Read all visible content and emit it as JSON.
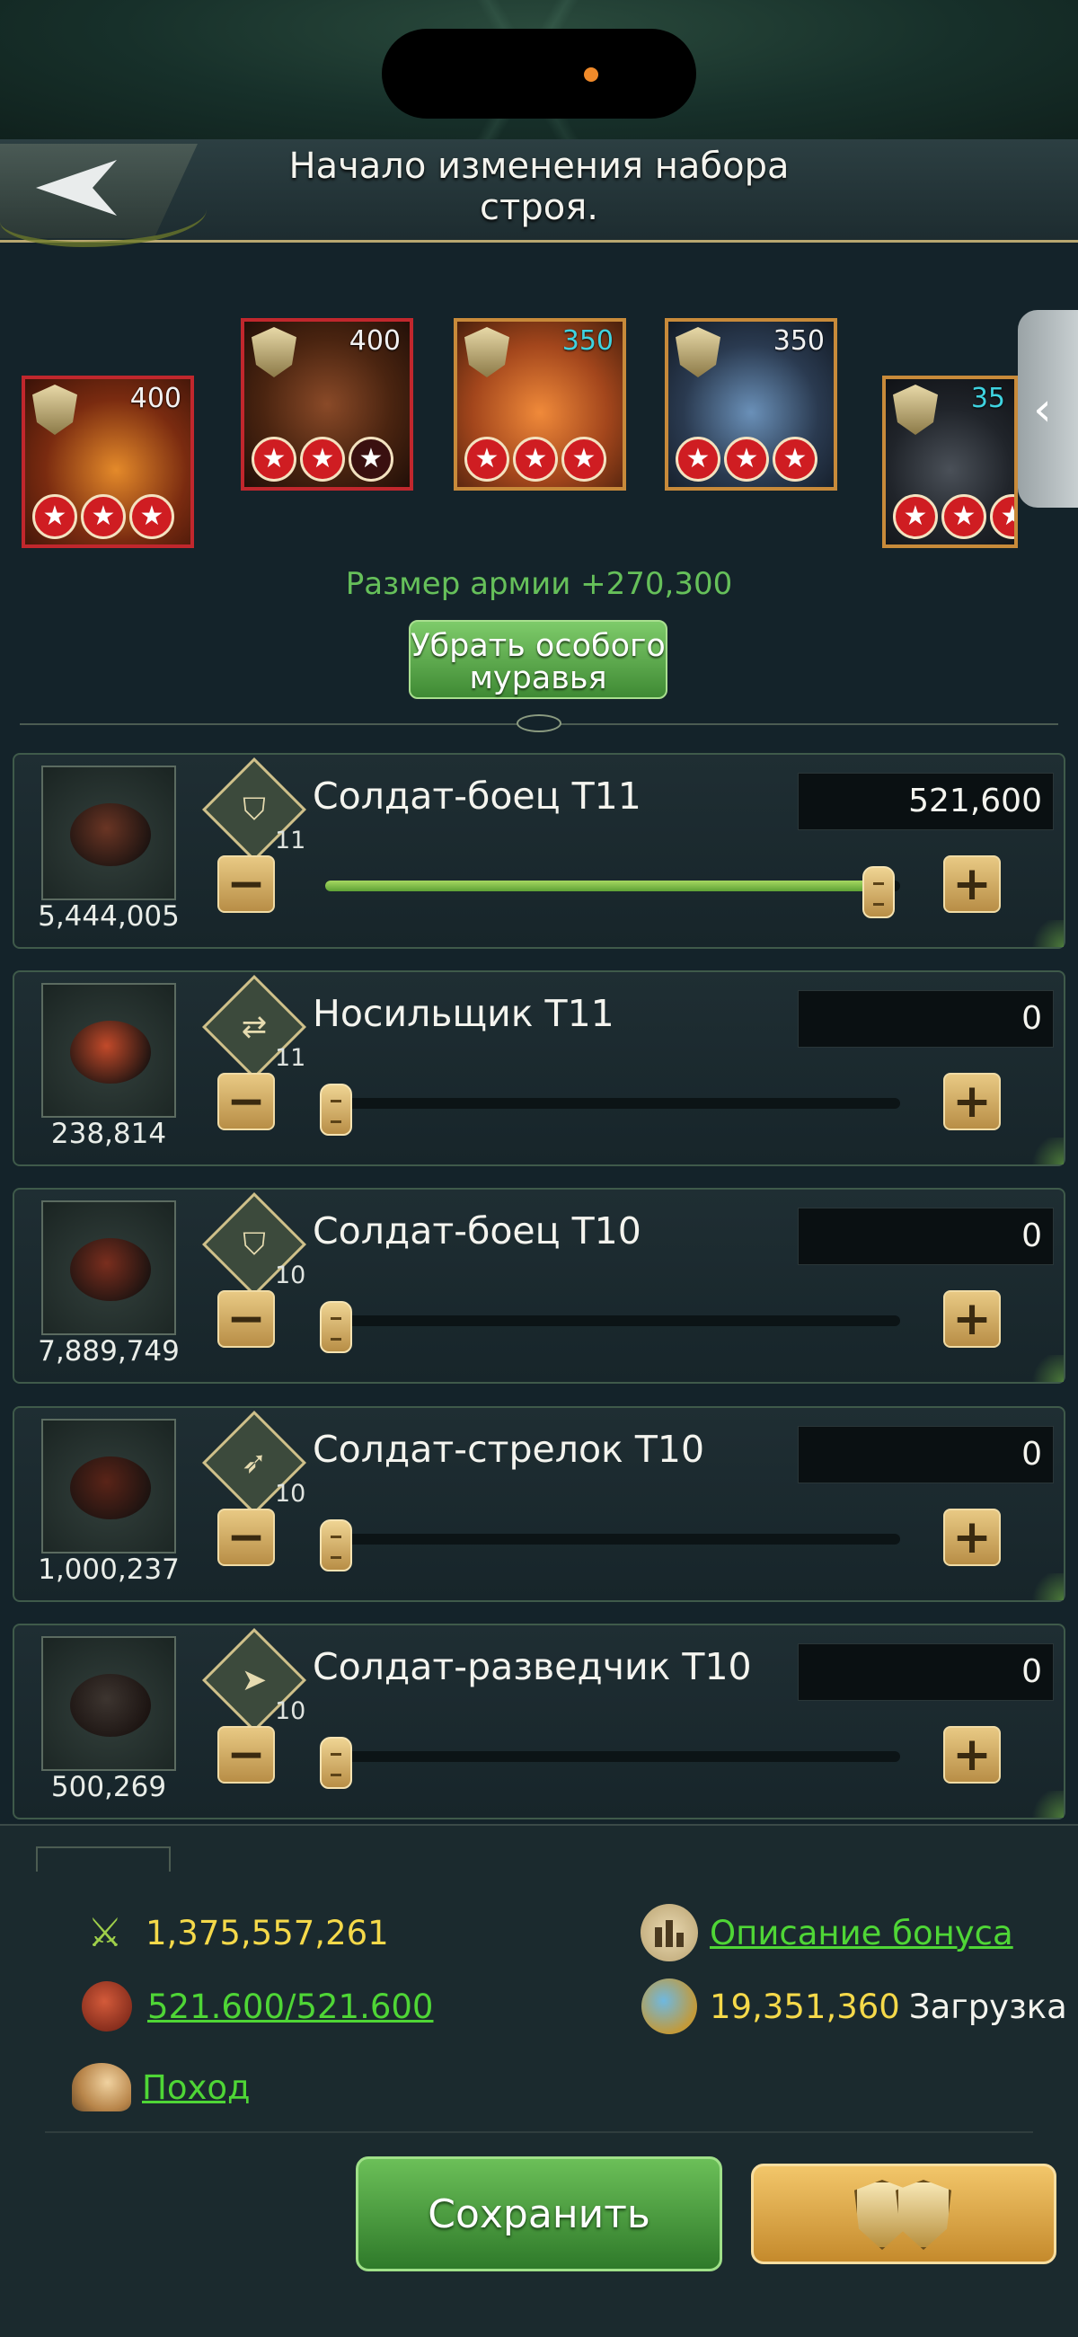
{
  "header": {
    "title": "Начало изменения набора строя."
  },
  "heroes": [
    {
      "level": "400",
      "level_color": "white",
      "frame": "red",
      "stars": [
        1,
        1,
        1
      ]
    },
    {
      "level": "400",
      "level_color": "white",
      "frame": "red",
      "stars": [
        1,
        1,
        0
      ]
    },
    {
      "level": "350",
      "level_color": "cyan",
      "frame": "orange",
      "stars": [
        1,
        1,
        1
      ]
    },
    {
      "level": "350",
      "level_color": "white",
      "frame": "orange",
      "stars": [
        1,
        1,
        1
      ]
    },
    {
      "level": "35",
      "level_color": "cyan",
      "frame": "orange",
      "stars": [
        1,
        1,
        1
      ]
    }
  ],
  "army_size": "Размер армии +270,300",
  "remove_special_ant_label": "Убрать особого муравья",
  "troops": [
    {
      "name": "Солдат-боец T11",
      "tier": "11",
      "count": "5,444,005",
      "value": "521,600",
      "fill_fraction": 1.0,
      "type_icon": "shield-icon",
      "icon_color": "#6a3524"
    },
    {
      "name": "Носильщик T11",
      "tier": "11",
      "count": "238,814",
      "value": "0",
      "fill_fraction": 0.0,
      "type_icon": "carrier-icon",
      "icon_color": "#c24a2a"
    },
    {
      "name": "Солдат-боец T10",
      "tier": "10",
      "count": "7,889,749",
      "value": "0",
      "fill_fraction": 0.0,
      "type_icon": "shield-icon",
      "icon_color": "#7a2e1e"
    },
    {
      "name": "Солдат-стрелок T10",
      "tier": "10",
      "count": "1,000,237",
      "value": "0",
      "fill_fraction": 0.0,
      "type_icon": "shooter-icon",
      "icon_color": "#5a2418"
    },
    {
      "name": "Солдат-разведчик T10",
      "tier": "10",
      "count": "500,269",
      "value": "0",
      "fill_fraction": 0.0,
      "type_icon": "scout-icon",
      "icon_color": "#3d3530"
    }
  ],
  "bottom": {
    "power": "1,375,557,261",
    "capacity": "521.600/521.600",
    "bonus_link": "Описание бонуса",
    "load_value": "19,351,360",
    "load_label": "Загрузка",
    "march_link": "Поход",
    "save_label": "Сохранить"
  },
  "colors": {
    "accent_green": "#4fd636",
    "accent_yellow": "#f5d94a",
    "gold": "#c58a2c"
  }
}
